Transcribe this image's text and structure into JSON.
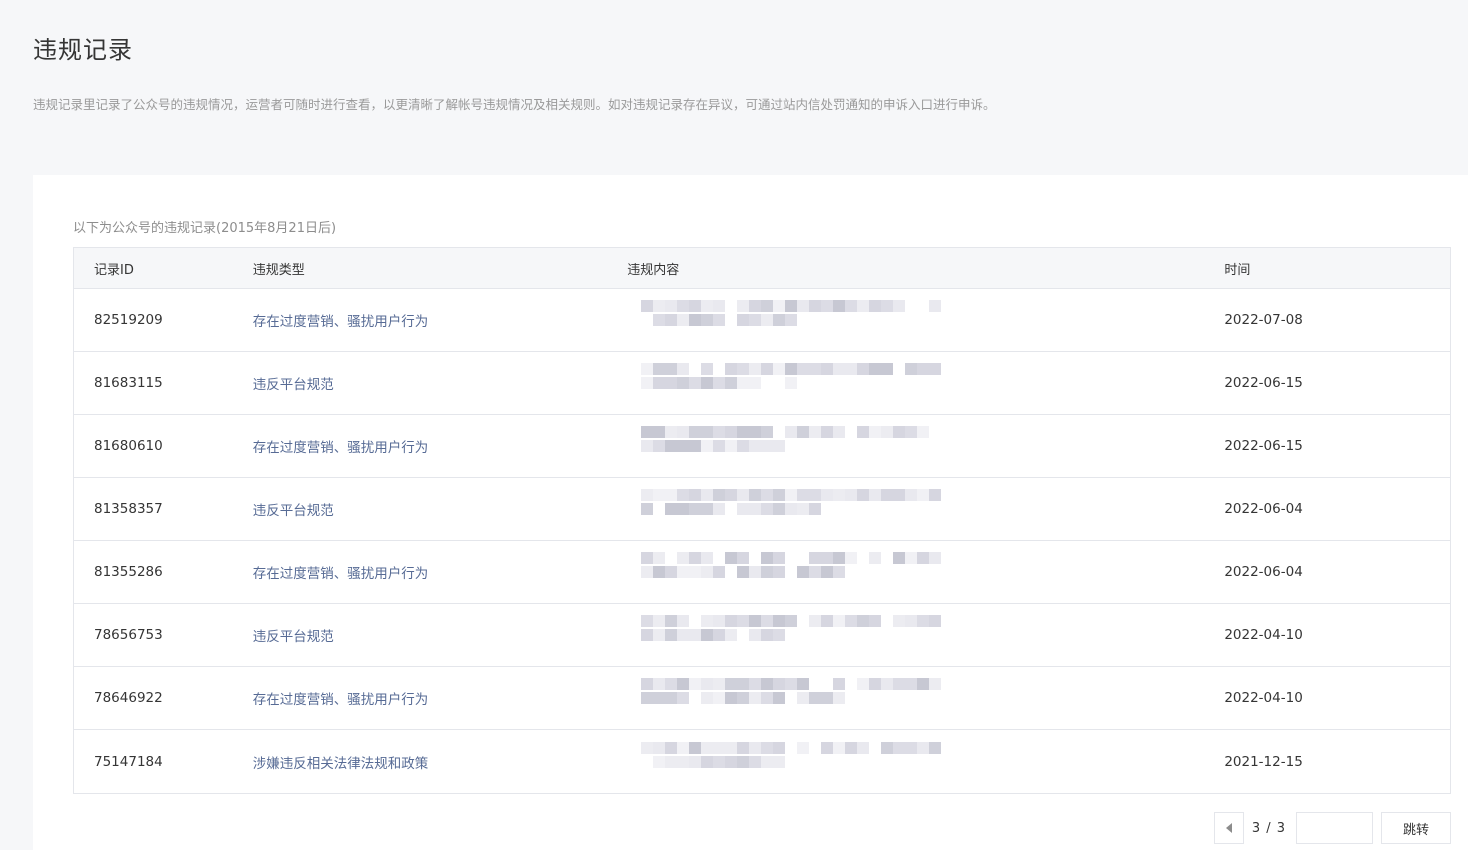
{
  "page": {
    "title": "违规记录",
    "description": "违规记录里记录了公众号的违规情况，运营者可随时进行查看，以更清晰了解帐号违规情况及相关规则。如对违规记录存在异议，可通过站内信处罚通知的申诉入口进行申诉。"
  },
  "table": {
    "caption": "以下为公众号的违规记录(2015年8月21日后)",
    "headers": [
      "记录ID",
      "违规类型",
      "违规内容",
      "时间"
    ],
    "rows": [
      {
        "id": "82519209",
        "type": "存在过度营销、骚扰用户行为",
        "time": "2022-07-08"
      },
      {
        "id": "81683115",
        "type": "违反平台规范",
        "time": "2022-06-15"
      },
      {
        "id": "81680610",
        "type": "存在过度营销、骚扰用户行为",
        "time": "2022-06-15"
      },
      {
        "id": "81358357",
        "type": "违反平台规范",
        "time": "2022-06-04"
      },
      {
        "id": "81355286",
        "type": "存在过度营销、骚扰用户行为",
        "time": "2022-06-04"
      },
      {
        "id": "78656753",
        "type": "违反平台规范",
        "time": "2022-04-10"
      },
      {
        "id": "78646922",
        "type": "存在过度营销、骚扰用户行为",
        "time": "2022-04-10"
      },
      {
        "id": "75147184",
        "type": "涉嫌违反相关法律法规和政策",
        "time": "2021-12-15"
      }
    ]
  },
  "pagination": {
    "page_indicator": "3 / 3",
    "jump_value": "",
    "jump_label": "跳转",
    "prev_icon": "caret-left-icon"
  },
  "colors": {
    "link": "#576b95",
    "background": "#f6f7f9",
    "border": "#e4e6eb"
  }
}
